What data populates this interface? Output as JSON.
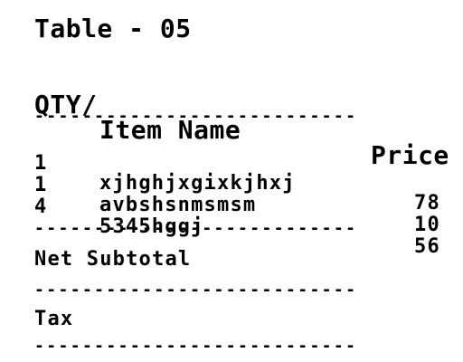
{
  "receipt": {
    "title": "Table - 05",
    "header": {
      "qty": "QTY/",
      "item": "Item Name",
      "price": "Price"
    },
    "separator": "---------------------------",
    "items": [
      {
        "qty": "1",
        "name": "xjhghjxgixkjhxj",
        "price": "78"
      },
      {
        "qty": "1",
        "name": "avbshsnmsmsm",
        "price": "10"
      },
      {
        "qty": "4",
        "name": "5345hggj",
        "price": "56"
      }
    ],
    "net_subtotal_label": "Net Subtotal",
    "tax_label": "Tax"
  }
}
